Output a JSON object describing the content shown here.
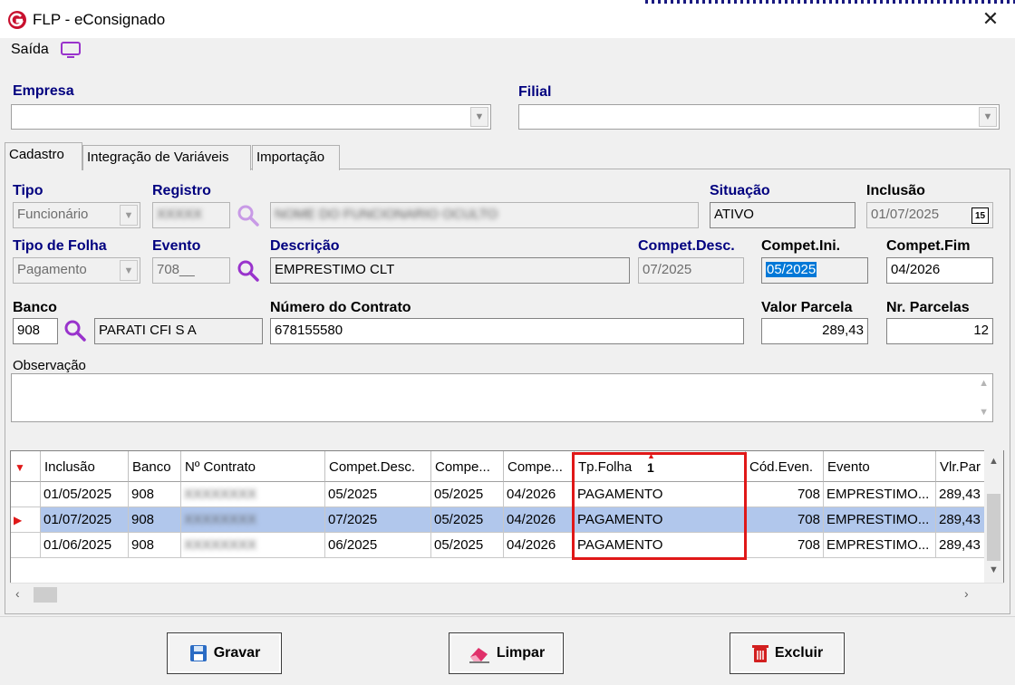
{
  "window": {
    "app_name": "FLP - eConsignado",
    "close_symbol": "✕"
  },
  "menu": {
    "saida_label": "Saída"
  },
  "empresa": {
    "label": "Empresa",
    "value": ""
  },
  "filial": {
    "label": "Filial",
    "value": ""
  },
  "tabs": [
    {
      "label": "Cadastro",
      "active": true
    },
    {
      "label": "Integração de Variáveis",
      "active": false
    },
    {
      "label": "Importação",
      "active": false
    }
  ],
  "form": {
    "tipo": {
      "label": "Tipo",
      "value": "Funcionário"
    },
    "registro": {
      "label": "Registro",
      "value": "XXXXX",
      "name": "NOME DO FUNCIONARIO OCULTO"
    },
    "situacao": {
      "label": "Situação",
      "value": "ATIVO"
    },
    "inclusao": {
      "label": "Inclusão",
      "value": "01/07/2025",
      "calendar_icon_text": "15"
    },
    "tipo_folha": {
      "label": "Tipo de Folha",
      "value": "Pagamento"
    },
    "evento": {
      "label": "Evento",
      "value": "708__"
    },
    "descricao": {
      "label": "Descrição",
      "value": "EMPRESTIMO CLT"
    },
    "compet_desc": {
      "label": "Compet.Desc.",
      "value": "07/2025"
    },
    "compet_ini": {
      "label": "Compet.Ini.",
      "value": "05/2025"
    },
    "compet_fim": {
      "label": "Compet.Fim",
      "value": "04/2026"
    },
    "banco": {
      "label": "Banco",
      "value": "908",
      "name": "PARATI CFI S A"
    },
    "numero_contrato": {
      "label": "Número do Contrato",
      "value": "678155580"
    },
    "valor_parcela": {
      "label": "Valor Parcela",
      "value": "289,43"
    },
    "nr_parcelas": {
      "label": "Nr. Parcelas",
      "value": "12"
    },
    "observacao": {
      "label": "Observação",
      "value": ""
    }
  },
  "grid": {
    "columns": [
      "Inclusão",
      "Banco",
      "Nº Contrato",
      "Compet.Desc.",
      "Compe...",
      "Compe...",
      "Tp.Folha",
      "Cód.Even.",
      "Evento",
      "Vlr.Par"
    ],
    "sort_badge": "1",
    "rows": [
      [
        "01/05/2025",
        "908",
        "XXXXXXXX",
        "05/2025",
        "05/2025",
        "04/2026",
        "PAGAMENTO",
        "708",
        "EMPRESTIMO...",
        "289,43"
      ],
      [
        "01/07/2025",
        "908",
        "XXXXXXXX",
        "07/2025",
        "05/2025",
        "04/2026",
        "PAGAMENTO",
        "708",
        "EMPRESTIMO...",
        "289,43"
      ],
      [
        "01/06/2025",
        "908",
        "XXXXXXXX",
        "06/2025",
        "05/2025",
        "04/2026",
        "PAGAMENTO",
        "708",
        "EMPRESTIMO...",
        "289,43"
      ]
    ],
    "selected_row": 1
  },
  "buttons": {
    "gravar": "Gravar",
    "limpar": "Limpar",
    "excluir": "Excluir"
  },
  "colors": {
    "label_blue": "#00007f",
    "selection": "#b1c7ec",
    "highlight": "#e01818",
    "search_icon": "#9933cc"
  }
}
